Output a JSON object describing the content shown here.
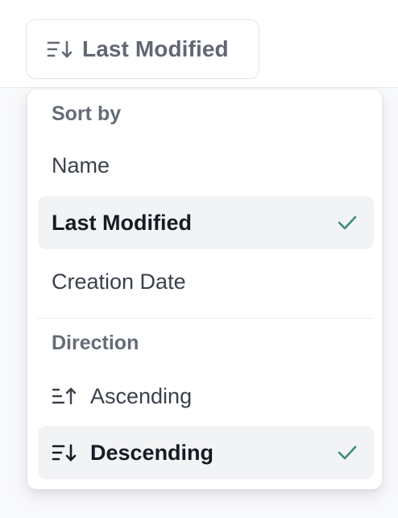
{
  "trigger": {
    "label": "Last Modified",
    "icon": "sort-descending-icon"
  },
  "menu": {
    "sort_by": {
      "heading": "Sort by",
      "items": [
        {
          "label": "Name",
          "selected": false
        },
        {
          "label": "Last Modified",
          "selected": true
        },
        {
          "label": "Creation Date",
          "selected": false
        }
      ]
    },
    "direction": {
      "heading": "Direction",
      "items": [
        {
          "label": "Ascending",
          "icon": "sort-ascending-icon",
          "selected": false
        },
        {
          "label": "Descending",
          "icon": "sort-descending-icon",
          "selected": true
        }
      ]
    }
  },
  "colors": {
    "check": "#3c8c7a",
    "selected_bg": "#f2f3f5",
    "muted_text": "#666c77"
  }
}
